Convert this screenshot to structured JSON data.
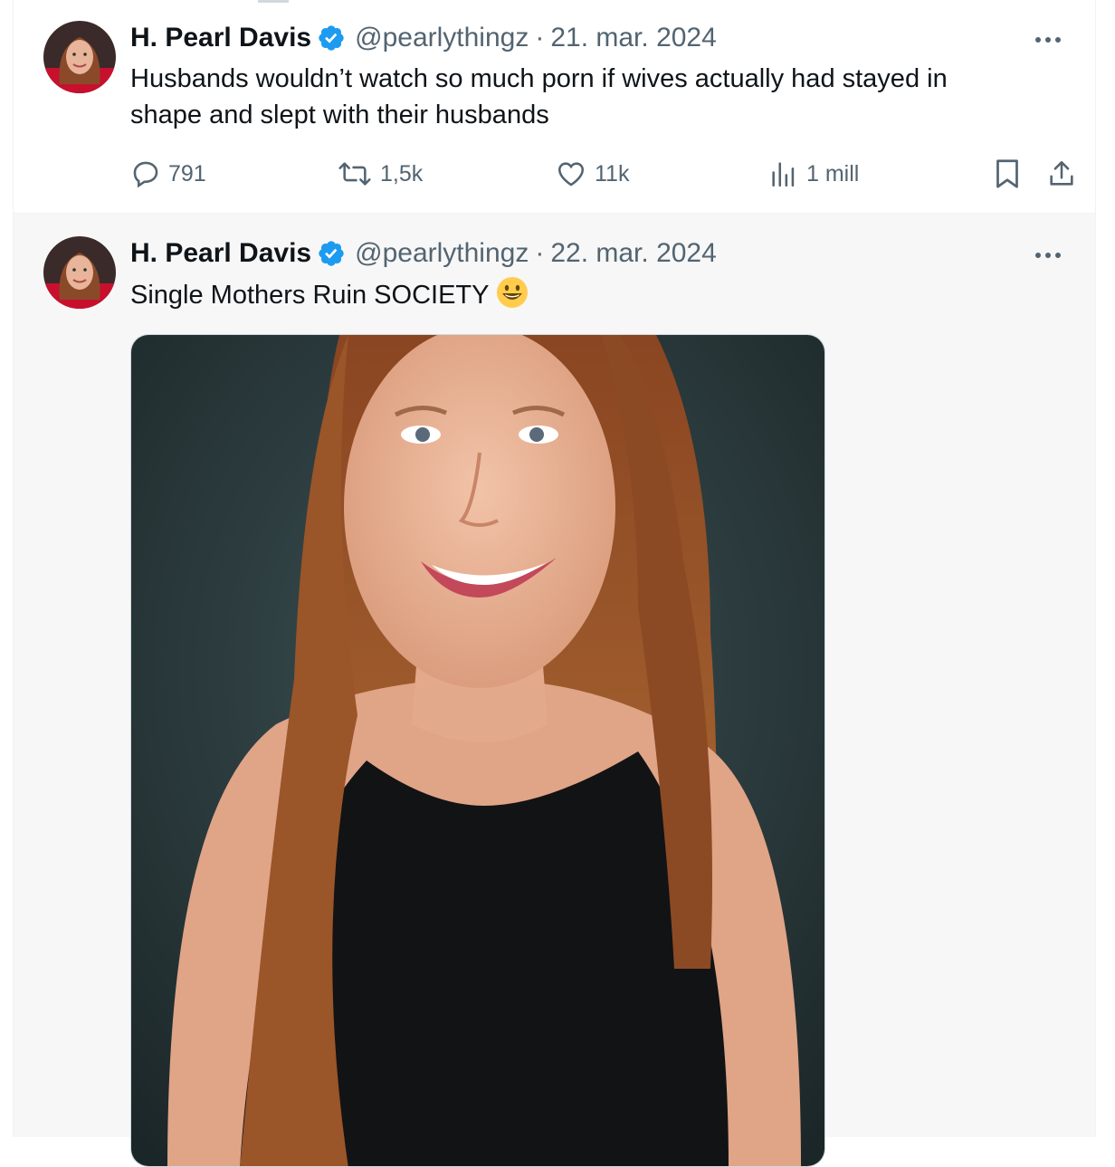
{
  "tweets": [
    {
      "author": {
        "name": "H. Pearl Davis",
        "handle": "@pearlythingz",
        "verified_icon": "verified-badge-icon"
      },
      "separator": "·",
      "date": "21. mar. 2024",
      "text": "Husbands wouldn’t watch so much porn if wives actually had stayed in shape and slept with their husbands",
      "actions": {
        "replies": "791",
        "reposts": "1,5k",
        "likes": "11k",
        "views": "1 mill"
      }
    },
    {
      "author": {
        "name": "H. Pearl Davis",
        "handle": "@pearlythingz",
        "verified_icon": "verified-badge-icon"
      },
      "separator": "·",
      "date": "22. mar. 2024",
      "text": "Single Mothers Ruin SOCIETY",
      "emoji": "grinning-face-emoji"
    }
  ],
  "colors": {
    "accent": "#1d9bf0",
    "secondary_text": "#536471",
    "primary_text": "#0f1419"
  }
}
